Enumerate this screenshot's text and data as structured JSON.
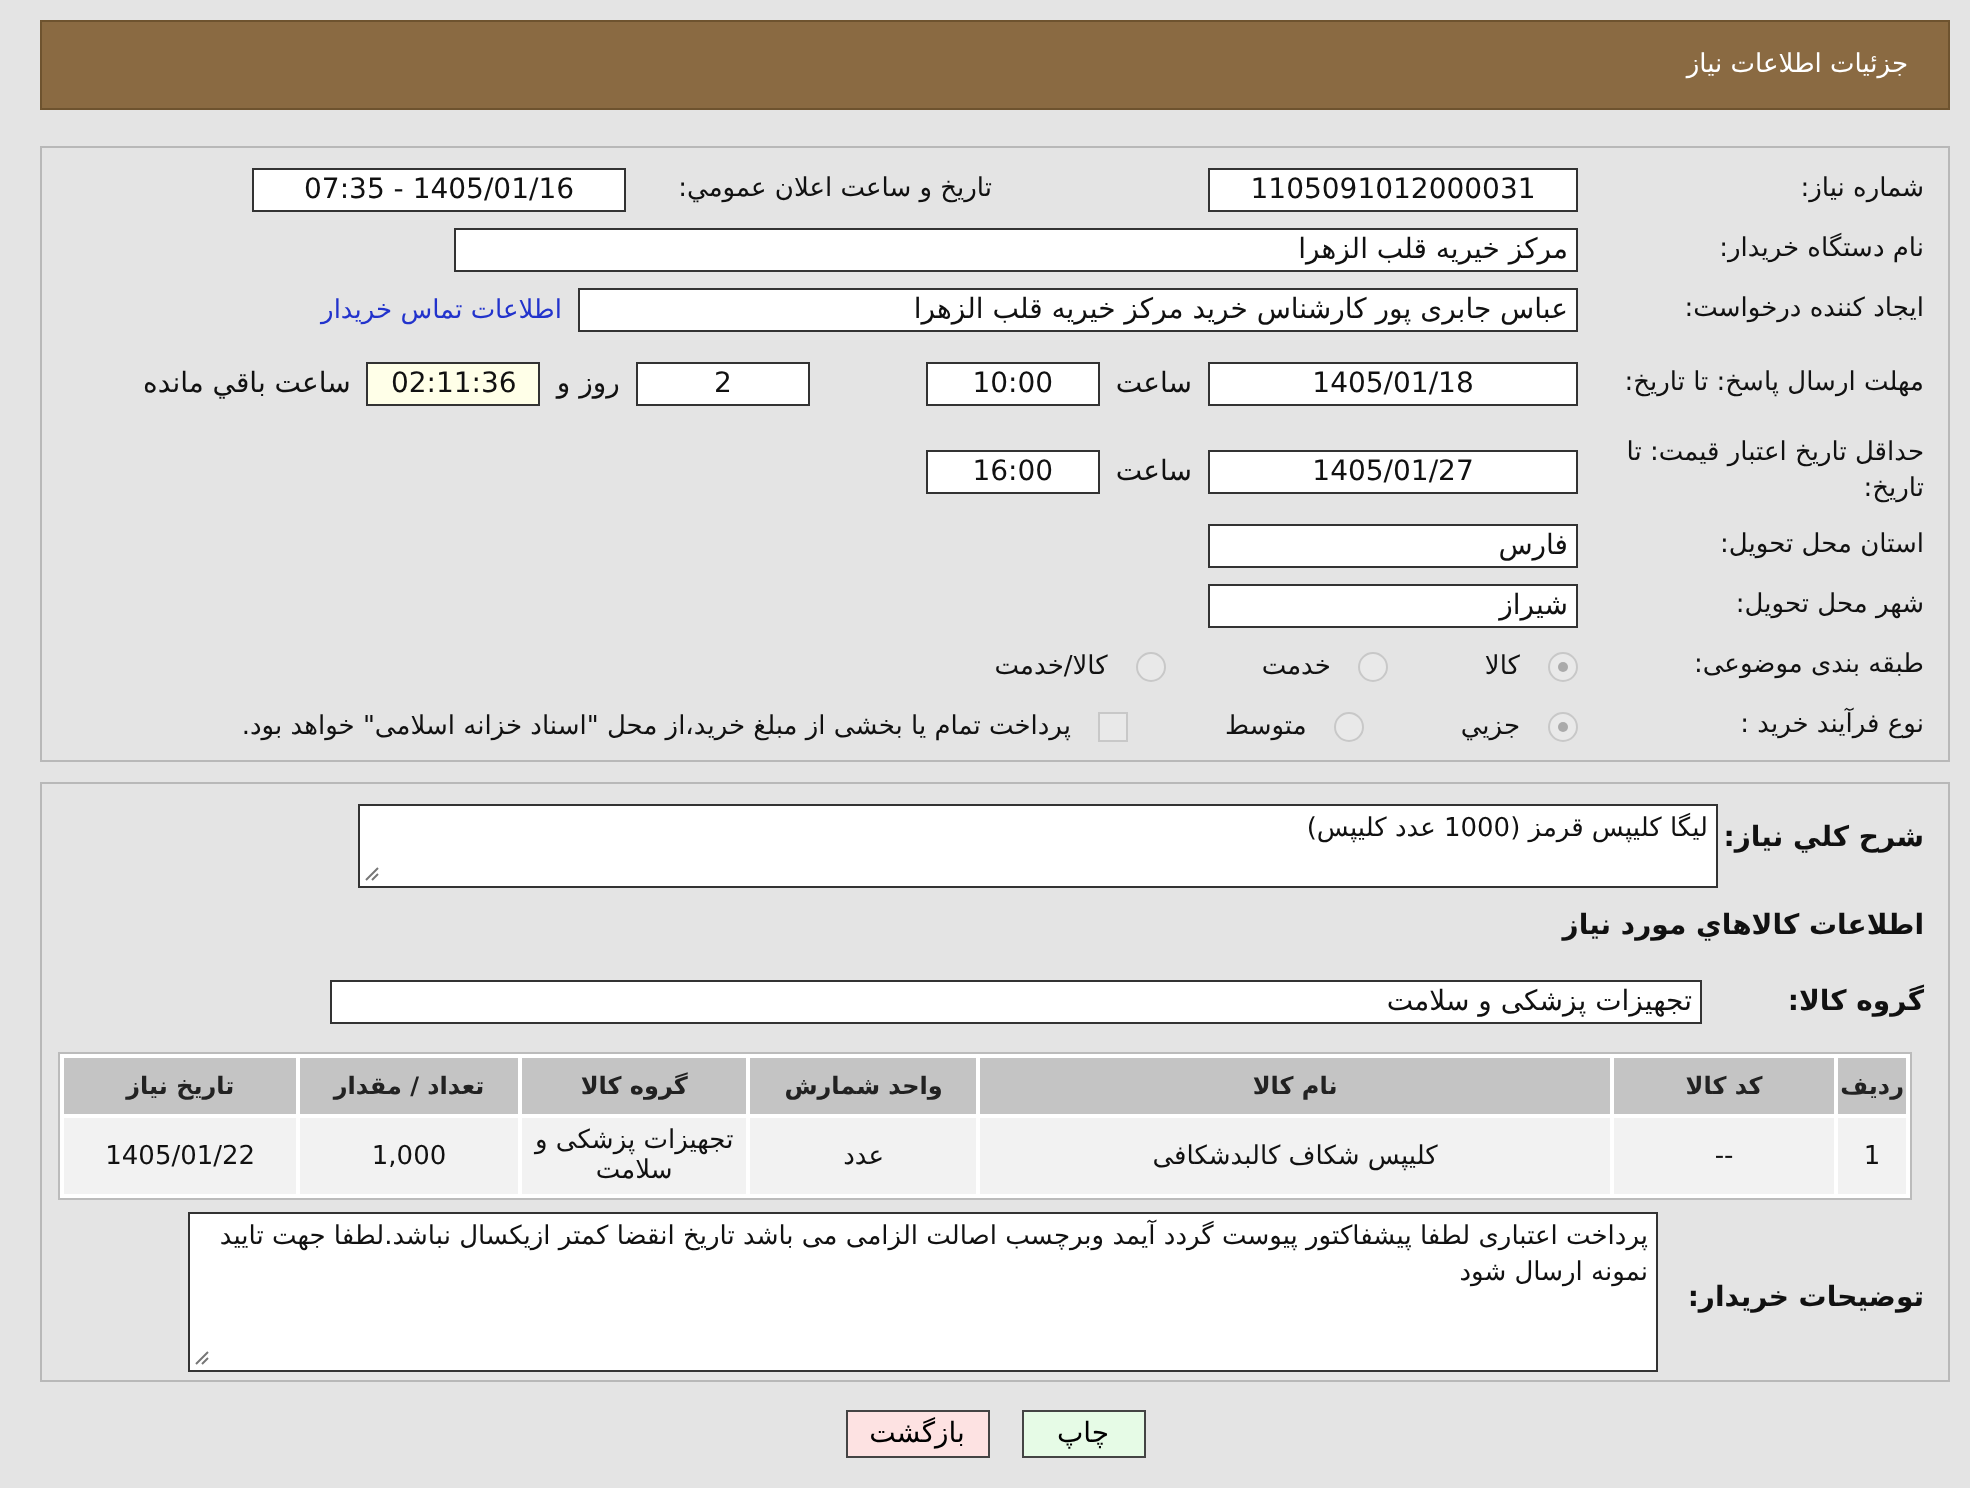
{
  "header": {
    "title": "جزئيات اطلاعات نياز"
  },
  "need_number": {
    "label": "شماره نیاز:",
    "value": "1105091012000031"
  },
  "announce": {
    "label": "تاريخ و ساعت اعلان عمومي:",
    "value": "1405/01/16 - 07:35"
  },
  "buyer": {
    "label": "نام دستگاه خریدار:",
    "value": "مرکز خیریه قلب الزهرا"
  },
  "requester": {
    "label": "ایجاد کننده درخواست:",
    "value": "عباس جابری پور کارشناس خرید مرکز خیریه قلب الزهرا",
    "link": "اطلاعات تماس خريدار"
  },
  "response_deadline": {
    "label": "مهلت ارسال پاسخ: تا تاریخ:",
    "date": "1405/01/18",
    "time_label": "ساعت",
    "time": "10:00",
    "days": "2",
    "days_label": "روز و",
    "remaining": "02:11:36",
    "remaining_label": "ساعت باقي مانده"
  },
  "price_validity": {
    "label": "حداقل تاریخ اعتبار قیمت: تا تاریخ:",
    "date": "1405/01/27",
    "time_label": "ساعت",
    "time": "16:00"
  },
  "province": {
    "label": "استان محل تحویل:",
    "value": "فارس"
  },
  "city": {
    "label": "شهر محل تحویل:",
    "value": "شیراز"
  },
  "category": {
    "label": "طبقه بندی موضوعی:",
    "options": [
      {
        "label": "کالا",
        "selected": true
      },
      {
        "label": "خدمت",
        "selected": false
      },
      {
        "label": "کالا/خدمت",
        "selected": false
      }
    ]
  },
  "purchase_type": {
    "label": "نوع فرآیند خرید :",
    "options": [
      {
        "label": "جزيي",
        "selected": true
      },
      {
        "label": "متوسط",
        "selected": false
      }
    ],
    "treasury": {
      "label": "پرداخت تمام یا بخشی از مبلغ خرید،از محل \"اسناد خزانه اسلامی\" خواهد بود.",
      "checked": false
    }
  },
  "description": {
    "label": "شرح کلي نياز:",
    "value": "لیگا کلیپس قرمز (1000 عدد کلیپس)"
  },
  "items_heading": "اطلاعات کالاهاي مورد نياز",
  "goods_group": {
    "label": "گروه کالا:",
    "value": "تجهیزات پزشکی و سلامت"
  },
  "table": {
    "columns": [
      "رديف",
      "کد کالا",
      "نام کالا",
      "واحد شمارش",
      "گروه کالا",
      "تعداد / مقدار",
      "تاريخ نياز"
    ],
    "rows": [
      [
        "1",
        "--",
        "کلیپس شکاف کالبدشکافی",
        "عدد",
        "تجهیزات پزشکی و سلامت",
        "1,000",
        "1405/01/22"
      ]
    ]
  },
  "buyer_notes": {
    "label": "توضیحات خریدار:",
    "value": "پرداخت اعتباری لطفا پیشفاکتور پیوست گردد آیمد وبرچسب اصالت الزامی می باشد تاریخ انقضا کمتر ازیکسال نباشد.لطفا جهت تایید نمونه ارسال شود"
  },
  "buttons": [
    {
      "label": "چاپ",
      "kind": "print"
    },
    {
      "label": "بازگشت",
      "kind": "back"
    }
  ]
}
